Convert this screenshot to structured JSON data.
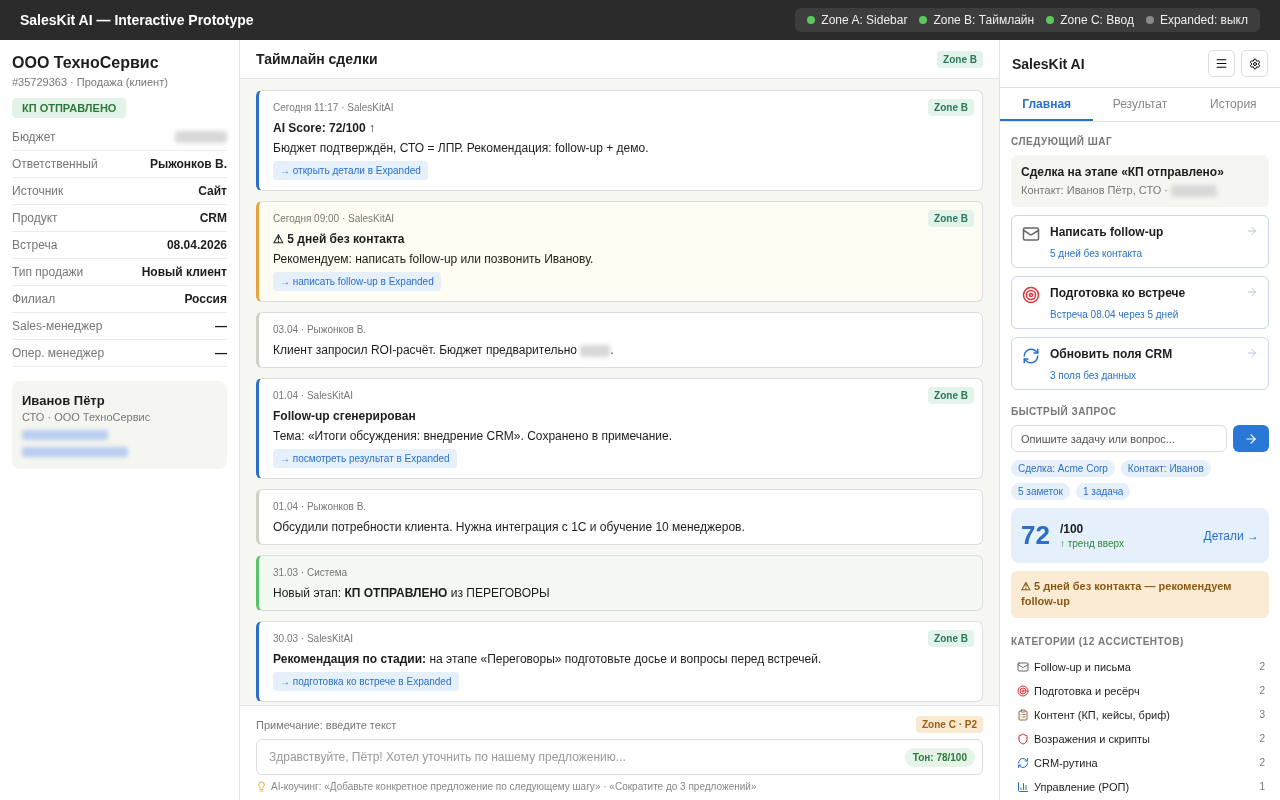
{
  "topbar": {
    "title": "SalesKit AI — Interactive Prototype",
    "zones": [
      {
        "label": "Zone A: Sidebar",
        "on": true
      },
      {
        "label": "Zone B: Таймлайн",
        "on": true
      },
      {
        "label": "Zone C: Ввод",
        "on": true
      },
      {
        "label": "Expanded: выкл",
        "on": false
      }
    ]
  },
  "sidebar": {
    "deal_title": "ООО ТехноСервис",
    "deal_meta": "#35729363 · Продажа (клиент)",
    "stage": "КП ОТПРАВЛЕНО",
    "fields": [
      {
        "label": "Бюджет",
        "redacted": true
      },
      {
        "label": "Ответственный",
        "value": "Рыжонков В."
      },
      {
        "label": "Источник",
        "value": "Сайт"
      },
      {
        "label": "Продукт",
        "value": "CRM"
      },
      {
        "label": "Встреча",
        "value": "08.04.2026"
      },
      {
        "label": "Тип продажи",
        "value": "Новый клиент"
      },
      {
        "label": "Филиал",
        "value": "Россия"
      },
      {
        "label": "Sales-менеджер",
        "value": "—"
      },
      {
        "label": "Опер. менеджер",
        "value": "—"
      }
    ],
    "contact": {
      "name": "Иванов Пётр",
      "role": "СТО · ООО ТехноСервис",
      "redacted_lines": true
    }
  },
  "timeline": {
    "title": "Таймлайн сделки",
    "badge": "Zone B",
    "entries": [
      {
        "kind": "ai",
        "meta": "Сегодня 11:17 · SalesKitAI",
        "badge": "Zone B",
        "title": "AI Score: 72/100 ↑",
        "body": "Бюджет подтверждён, СТО = ЛПР. Рекомендация: follow-up + демо.",
        "link": "→ открыть детали в Expanded"
      },
      {
        "kind": "warning",
        "meta": "Сегодня 09:00 · SalesKitAI",
        "badge": "Zone B",
        "title": "⚠ 5 дней без контакта",
        "body": "Рекомендуем: написать follow-up или позвонить Иванову.",
        "link": "→ написать follow-up в Expanded"
      },
      {
        "kind": "note",
        "meta": "03.04 · Рыжонков В.",
        "body": "Клиент запросил ROI-расчёт. Бюджет предварительно",
        "redacted": true,
        "body_after": "."
      },
      {
        "kind": "ai",
        "meta": "01.04 · SalesKitAI",
        "badge": "Zone B",
        "title": "Follow-up сгенерирован",
        "body": "Тема: «Итоги обсуждения: внедрение CRM». Сохранено в примечание.",
        "link": "→ посмотреть результат в Expanded"
      },
      {
        "kind": "note",
        "meta": "01.04 · Рыжонков В.",
        "body": "Обсудили потребности клиента. Нужна интеграция с 1С и обучение 10 менеджеров."
      },
      {
        "kind": "system",
        "meta": "31.03 · Система",
        "body": "Новый этап: **КП ОТПРАВЛЕНО** из ПЕРЕГОВОРЫ"
      },
      {
        "kind": "ai",
        "meta": "30.03 · SalesKitAI",
        "badge": "Zone B",
        "body": "**Рекомендация по стадии:** на этапе «Переговоры» подготовьте досье и вопросы перед встречей.",
        "link": "→ подготовка ко встрече в Expanded"
      }
    ]
  },
  "composer": {
    "label": "Примечание: введите текст",
    "badge": "Zone C · P2",
    "placeholder": "Здравствуйте, Пётр! Хотел уточнить по нашему предложению...",
    "tone": "Тон: 78/100",
    "coach": "AI-коучинг: «Добавьте конкретное предложение по следующему шагу» · «Сократите до 3 предложений»"
  },
  "assistant": {
    "title": "SalesKit AI",
    "tabs": [
      {
        "label": "Главная",
        "selected": true
      },
      {
        "label": "Результат",
        "selected": false
      },
      {
        "label": "История",
        "selected": false
      }
    ],
    "next_step_label": "СЛЕДУЮЩИЙ ШАГ",
    "next_step": {
      "title": "Сделка на этапе «КП отправлено»",
      "contact": "Контакт: Иванов Пётр, СТО ·",
      "redacted": true
    },
    "actions": [
      {
        "kind": "mail",
        "title": "Написать follow-up",
        "sub": "5 дней без контакта"
      },
      {
        "kind": "target",
        "title": "Подготовка ко встрече",
        "sub": "Встреча 08.04 через 5 дней"
      },
      {
        "kind": "refresh",
        "title": "Обновить поля CRM",
        "sub": "3 поля без данных"
      }
    ],
    "quick_label": "БЫСТРЫЙ ЗАПРОС",
    "quick_placeholder": "Опишите задачу или вопрос...",
    "chips": [
      "Сделка: Acme Corp",
      "Контакт: Иванов",
      "5 заметок",
      "1 задача"
    ],
    "score": {
      "value": "72",
      "max": "/100",
      "trend": "↑ тренд вверх",
      "link": "Детали →"
    },
    "alert": "⚠ 5 дней без контакта — рекомендуем follow-up",
    "categories_label": "КАТЕГОРИИ (12 АССИСТЕНТОВ)",
    "categories": [
      {
        "kind": "mail",
        "label": "Follow-up и письма",
        "count": "2"
      },
      {
        "kind": "target",
        "label": "Подготовка и ресёрч",
        "count": "2"
      },
      {
        "kind": "clipboard",
        "label": "Контент (КП, кейсы, бриф)",
        "count": "3"
      },
      {
        "kind": "shield",
        "label": "Возражения и скрипты",
        "count": "2"
      },
      {
        "kind": "refresh",
        "label": "CRM-рутина",
        "count": "2"
      },
      {
        "kind": "chart",
        "label": "Управление (РОП)",
        "count": "1"
      }
    ]
  }
}
